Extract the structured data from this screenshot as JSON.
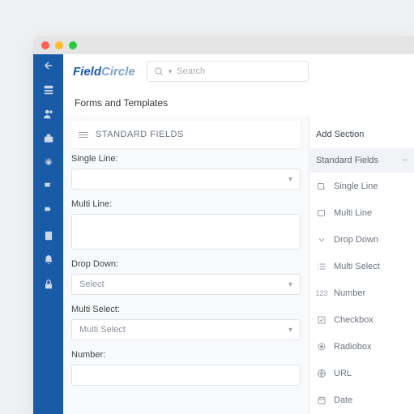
{
  "brand": {
    "part1": "Field",
    "part2": "Circle"
  },
  "search": {
    "placeholder": "Search"
  },
  "page_title": "Forms and Templates",
  "section_title": "STANDARD FIELDS",
  "fields": {
    "single_line": {
      "label": "Single Line:"
    },
    "multi_line": {
      "label": "Multi Line:"
    },
    "drop_down": {
      "label": "Drop Down:",
      "value": "Select"
    },
    "multi_select": {
      "label": "Multi Select:",
      "value": "Multi Select"
    },
    "number": {
      "label": "Number:"
    }
  },
  "right": {
    "title": "Add Section",
    "subtitle": "Standard Fields",
    "items": [
      "Single Line",
      "Multi Line",
      "Drop Down",
      "Multi Select",
      "Number",
      "Checkbox",
      "Radiobox",
      "URL",
      "Date"
    ]
  }
}
